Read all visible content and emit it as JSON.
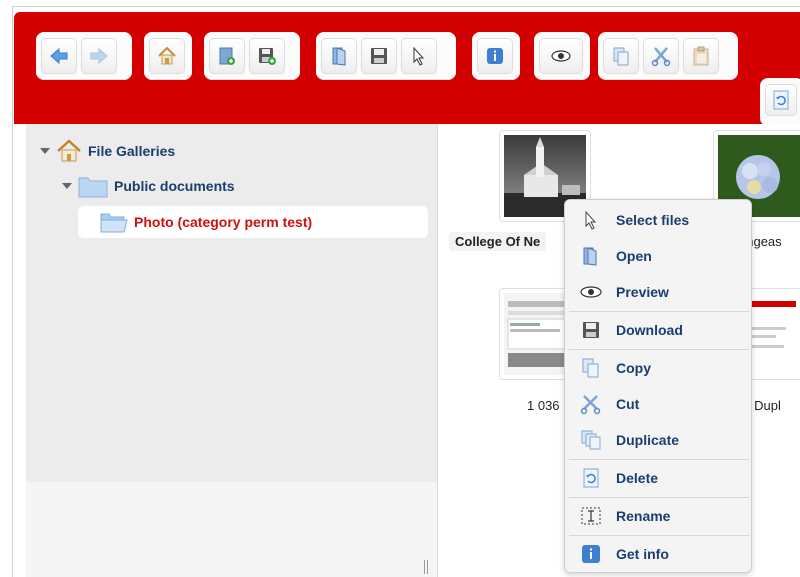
{
  "toolbar": {
    "groups": [
      {
        "name": "navigation",
        "buttons": [
          "back-icon",
          "forward-icon"
        ]
      },
      {
        "name": "home",
        "buttons": [
          "home-icon"
        ]
      },
      {
        "name": "upload-save",
        "buttons": [
          "upload-icon",
          "save-icon"
        ]
      },
      {
        "name": "open-download-select",
        "buttons": [
          "open-icon",
          "download-icon",
          "select-icon"
        ]
      },
      {
        "name": "info",
        "buttons": [
          "info-icon"
        ]
      },
      {
        "name": "preview",
        "buttons": [
          "preview-icon"
        ]
      },
      {
        "name": "clipboard",
        "buttons": [
          "copy-icon",
          "cut-icon",
          "paste-icon"
        ]
      },
      {
        "name": "refresh",
        "buttons": [
          "refresh-icon"
        ]
      }
    ]
  },
  "tree": {
    "root": "File Galleries",
    "child": "Public documents",
    "selected": "Photo (category perm test)"
  },
  "files": [
    {
      "name": "College Of Ne"
    },
    {
      "name": "angeas"
    },
    {
      "name": "1 036"
    },
    {
      "name": "er Dupl"
    }
  ],
  "context_menu": {
    "items": [
      {
        "label": "Select files",
        "icon": "cursor-icon"
      },
      {
        "label": "Open",
        "icon": "open-icon"
      },
      {
        "label": "Preview",
        "icon": "eye-icon"
      },
      {
        "label": "Download",
        "icon": "save-icon"
      },
      {
        "label": "Copy",
        "icon": "copy-icon"
      },
      {
        "label": "Cut",
        "icon": "scissors-icon"
      },
      {
        "label": "Duplicate",
        "icon": "duplicate-icon"
      },
      {
        "label": "Delete",
        "icon": "delete-icon"
      },
      {
        "label": "Rename",
        "icon": "rename-icon"
      },
      {
        "label": "Get info",
        "icon": "info-icon"
      }
    ]
  },
  "colors": {
    "toolbar": "#d40000",
    "tree_link": "#1a3e6e",
    "selected": "#cc1111",
    "accent_blue": "#3f7fd0"
  }
}
